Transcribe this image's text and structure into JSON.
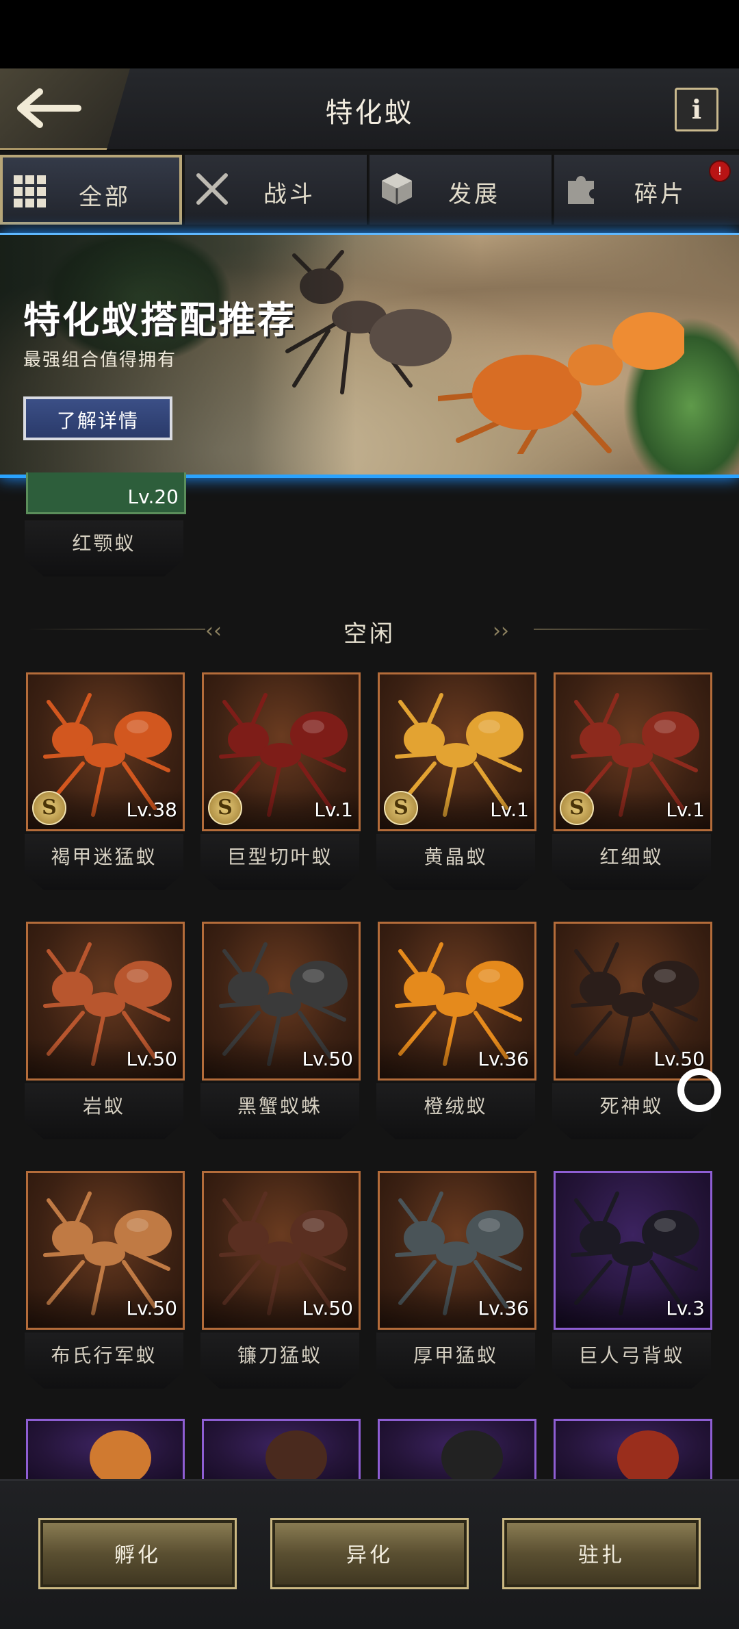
{
  "header": {
    "title": "特化蚁",
    "info_label": "i"
  },
  "tabs": [
    {
      "label": "全部",
      "icon": "grid-icon",
      "active": true
    },
    {
      "label": "战斗",
      "icon": "crossed-swords-icon",
      "active": false
    },
    {
      "label": "发展",
      "icon": "cube-icon",
      "active": false
    },
    {
      "label": "碎片",
      "icon": "puzzle-icon",
      "active": false,
      "badge": "!"
    }
  ],
  "banner": {
    "title": "特化蚁搭配推荐",
    "subtitle": "最强组合值得拥有",
    "button_label": "了解详情"
  },
  "deployed": {
    "level": "Lv.20",
    "name": "红颚蚁"
  },
  "section": {
    "label": "空闲"
  },
  "ants": [
    {
      "name": "褐甲迷猛蚁",
      "level": "Lv.38",
      "s_badge": "S",
      "color": "#d2571f",
      "rarity": "orange"
    },
    {
      "name": "巨型切叶蚁",
      "level": "Lv.1",
      "s_badge": "S",
      "color": "#7e1d18",
      "rarity": "orange"
    },
    {
      "name": "黄晶蚁",
      "level": "Lv.1",
      "s_badge": "S",
      "color": "#e3a332",
      "rarity": "orange"
    },
    {
      "name": "红细蚁",
      "level": "Lv.1",
      "s_badge": "S",
      "color": "#8d2a1d",
      "rarity": "orange"
    },
    {
      "name": "岩蚁",
      "level": "Lv.50",
      "color": "#b8562e",
      "rarity": "orange"
    },
    {
      "name": "黑蟹蚁蛛",
      "level": "Lv.50",
      "color": "#3a3a3a",
      "rarity": "orange"
    },
    {
      "name": "橙绒蚁",
      "level": "Lv.36",
      "color": "#e58a1c",
      "rarity": "orange"
    },
    {
      "name": "死神蚁",
      "level": "Lv.50",
      "color": "#2b1e1a",
      "rarity": "orange"
    },
    {
      "name": "布氏行军蚁",
      "level": "Lv.50",
      "color": "#c07a44",
      "rarity": "orange"
    },
    {
      "name": "镰刀猛蚁",
      "level": "Lv.50",
      "color": "#5a2f21",
      "rarity": "orange"
    },
    {
      "name": "厚甲猛蚁",
      "level": "Lv.36",
      "color": "#4a5458",
      "rarity": "orange"
    },
    {
      "name": "巨人弓背蚁",
      "level": "Lv.3",
      "color": "#1c1a24",
      "rarity": "purple"
    }
  ],
  "partial_row": [
    {
      "color": "#d07a30"
    },
    {
      "color": "#4a2a1e"
    },
    {
      "color": "#222222"
    },
    {
      "color": "#9a2e1c"
    }
  ],
  "bottom_buttons": [
    {
      "label": "孵化"
    },
    {
      "label": "异化"
    },
    {
      "label": "驻扎"
    }
  ]
}
